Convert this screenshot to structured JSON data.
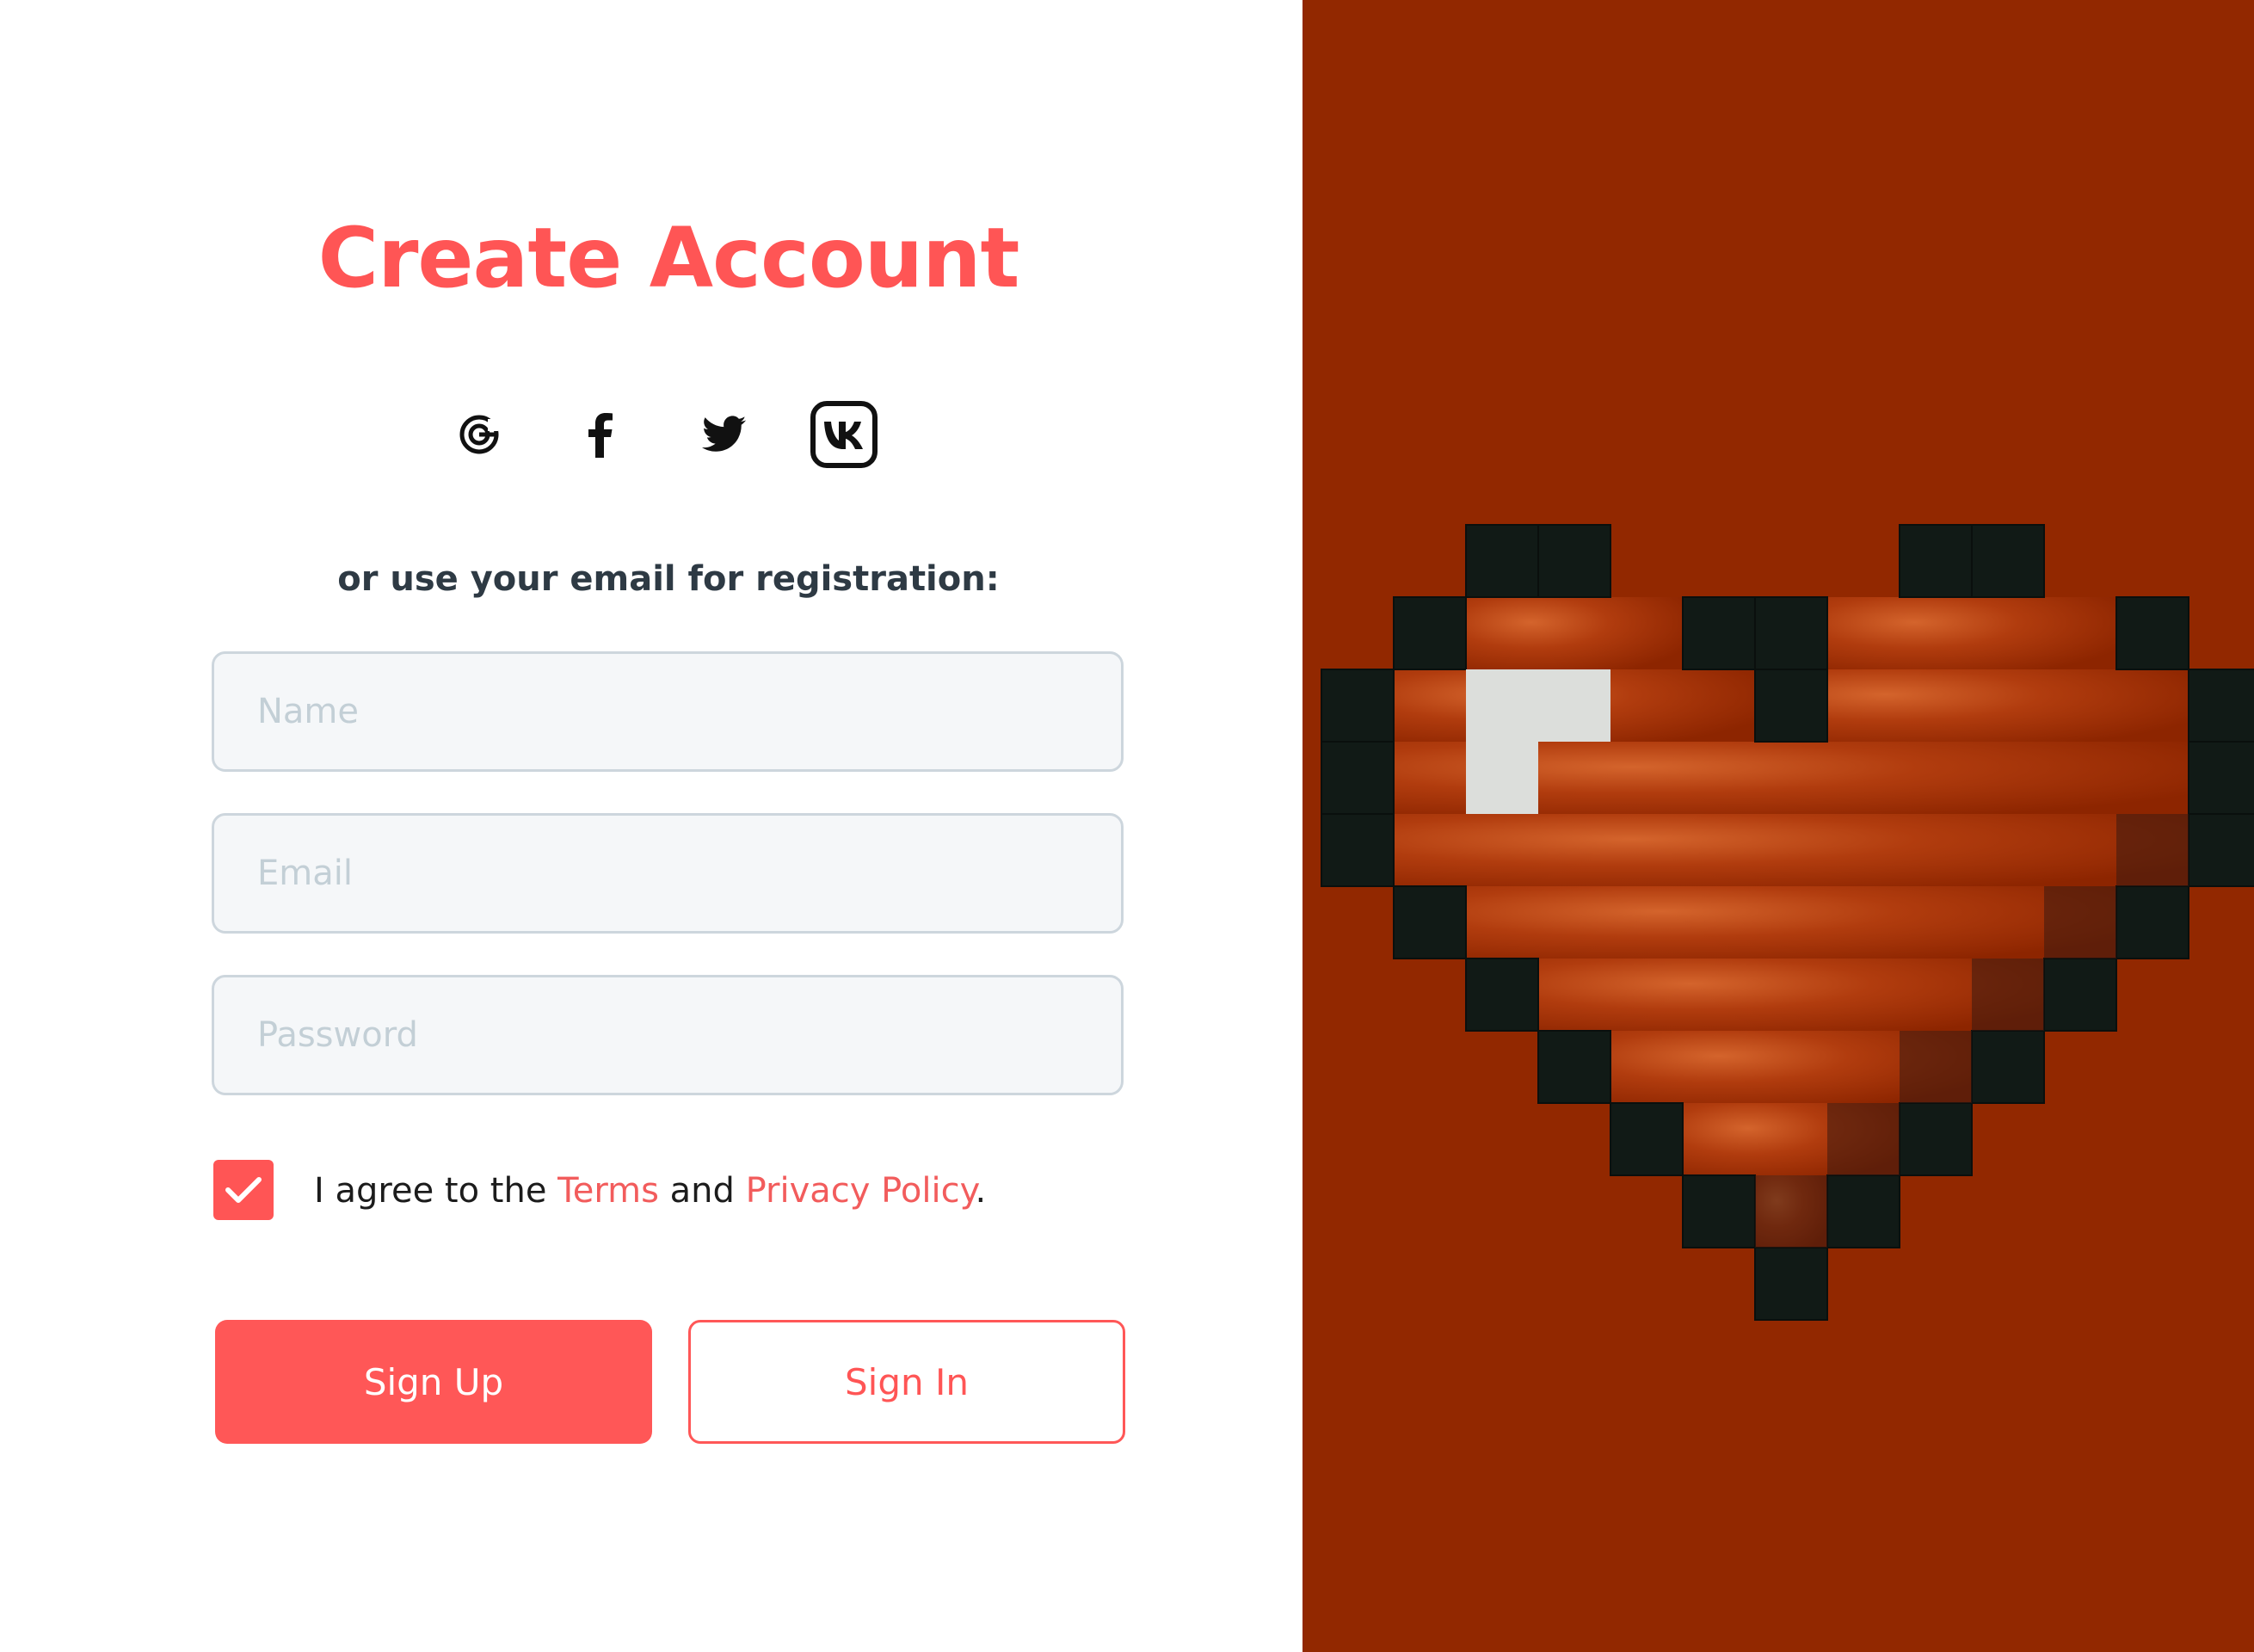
{
  "form": {
    "title": "Create Account",
    "subtitle": "or use your email for registration:",
    "name_placeholder": "Name",
    "email_placeholder": "Email",
    "password_placeholder": "Password",
    "agree_prefix": "I agree to the ",
    "terms_link": "Terms",
    "agree_middle": " and ",
    "privacy_link": "Privacy Policy",
    "agree_suffix": ".",
    "terms_checked": true,
    "sign_up_label": "Sign Up",
    "sign_in_label": "Sign In"
  },
  "social": [
    "google-icon",
    "facebook-icon",
    "twitter-icon",
    "vk-icon"
  ],
  "colors": {
    "accent": "#ff5555",
    "panel": "#922800"
  },
  "hero": {
    "image": "pixel-heart"
  }
}
